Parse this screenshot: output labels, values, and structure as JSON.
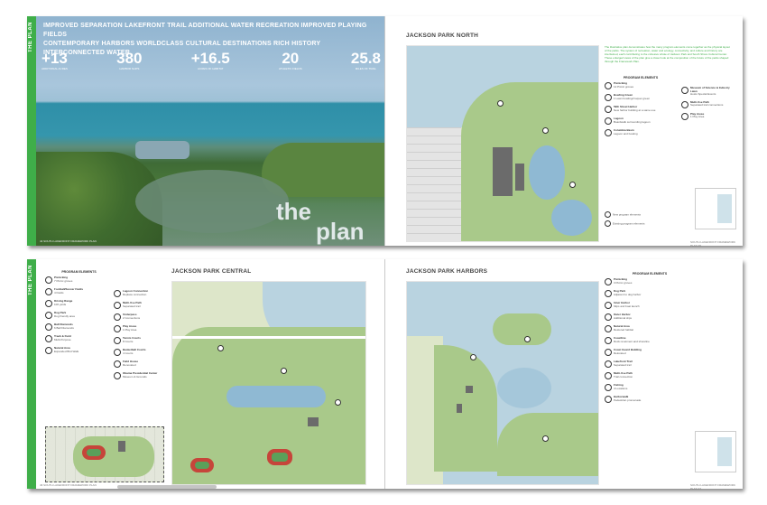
{
  "spread_top": {
    "tab_label": "THE PLAN",
    "headline_line1": "IMPROVED SEPARATION LAKEFRONT TRAIL  ADDITIONAL WATER RECREATION  IMPROVED PLAYING FIELDS",
    "headline_line2": "CONTEMPORARY HARBORS  WORLDCLASS CULTURAL DESTINATIONS  RICH HISTORY  INTERCONNECTED WATER",
    "stats": [
      {
        "value": "+13",
        "label": "ADDITIONAL ACRES"
      },
      {
        "value": "380",
        "label": "HARBOR SLIPS"
      },
      {
        "value": "+16.5",
        "label": "ACRES OF HABITAT"
      },
      {
        "value": "20",
        "label": "ATHLETIC FIELDS"
      },
      {
        "value": "25.8",
        "label": "MILES OF TRAIL"
      }
    ],
    "photo_title_a": "the",
    "photo_title_b": "plan",
    "folio_left": "44  SOUTH LAKEFRONT FRAMEWORK PLAN",
    "right_title": "JACKSON PARK NORTH",
    "intro_text": "The illustrative plan demonstrates how the many program elements come together as the physical layout of the parks. The system of recreation, water and ecology, connectivity, and culture and history are intertwined, each contributing to the cohesive whole of Jackson Park and South Shore Cultural Center. These enlarged views of the plan give a closer look at the composition of the future of the parks shaped through the Framework Plan.",
    "legend_heading": "PROGRAM ELEMENTS",
    "legend_col1": [
      {
        "t": "Picnicking",
        "d": "12 Picnic groves"
      },
      {
        "t": "Bowling Green",
        "d": "1 Lawn bowling/croquet green"
      },
      {
        "t": "59th Street Harbor",
        "d": "New harbor building at a same use"
      },
      {
        "t": "Lagoon",
        "d": "Boardwalk surrounding lagoon"
      },
      {
        "t": "Columbia Basin",
        "d": "Lagoon and boating"
      }
    ],
    "legend_col2": [
      {
        "t": "Museum of Science & Industry Lawn",
        "d": "Hosts Special Events"
      },
      {
        "t": "Multi-Use Path",
        "d": "Separated trail connections"
      },
      {
        "t": "Play Areas",
        "d": "1 Play Area"
      }
    ],
    "key_new": "New program elements",
    "key_existing": "Existing program elements",
    "folio_right": "SOUTH LAKEFRONT FRAMEWORK PLAN  45"
  },
  "spread_bottom": {
    "tab_label": "THE PLAN",
    "legend_heading": "PROGRAM ELEMENTS",
    "left_col1": [
      {
        "t": "Picnicking",
        "d": "7 Picnic groves"
      },
      {
        "t": "Football/Soccer Fields",
        "d": "4 Fields"
      },
      {
        "t": "Driving Range",
        "d": "100 yards"
      },
      {
        "t": "Dog Park",
        "d": "Dog friendly area"
      },
      {
        "t": "Ball Diamonds",
        "d": "6 Ball Diamonds"
      },
      {
        "t": "Track & Field",
        "d": "Multi-Purpose"
      },
      {
        "t": "Natural Area",
        "d": "Expanded Bird Walk"
      }
    ],
    "left_col2": [
      {
        "t": "Lagoon Connection",
        "d": "Replace connection"
      },
      {
        "t": "Multi-Use Path",
        "d": "Separated trail"
      },
      {
        "t": "Underpass",
        "d": "2 Connections"
      },
      {
        "t": "Play Areas",
        "d": "1 Play Area"
      },
      {
        "t": "Tennis Courts",
        "d": "8 Courts"
      },
      {
        "t": "Basketball Courts",
        "d": "4 Courts"
      },
      {
        "t": "Field House",
        "d": "Renovated"
      },
      {
        "t": "Obama Presidential Center",
        "d": "Museum & Grounds"
      }
    ],
    "map1_title": "JACKSON PARK CENTRAL",
    "map2_title": "JACKSON PARK HARBORS",
    "right_col": [
      {
        "t": "Picnicking",
        "d": "3 Picnic groves"
      },
      {
        "t": "Dog Park",
        "d": "Adjacent to dog harbor"
      },
      {
        "t": "Inner Harbor",
        "d": "Slips and boat launch"
      },
      {
        "t": "Outer Harbor",
        "d": "Additional slips"
      },
      {
        "t": "Natural Area",
        "d": "Restored habitat"
      },
      {
        "t": "Coastline",
        "d": "Rock revetment and shoreline"
      },
      {
        "t": "Coast Guard Building",
        "d": "Relocated"
      },
      {
        "t": "Lakefront Trail",
        "d": "Separated trail"
      },
      {
        "t": "Multi-Use Path",
        "d": "Trail connection"
      },
      {
        "t": "Fishing",
        "d": "4 Locations"
      },
      {
        "t": "Harborwalk",
        "d": "Pedestrian promenade"
      }
    ],
    "folio_left": "46  SOUTH LAKEFRONT FRAMEWORK PLAN",
    "folio_right": "SOUTH LAKEFRONT FRAMEWORK PLAN  47"
  }
}
